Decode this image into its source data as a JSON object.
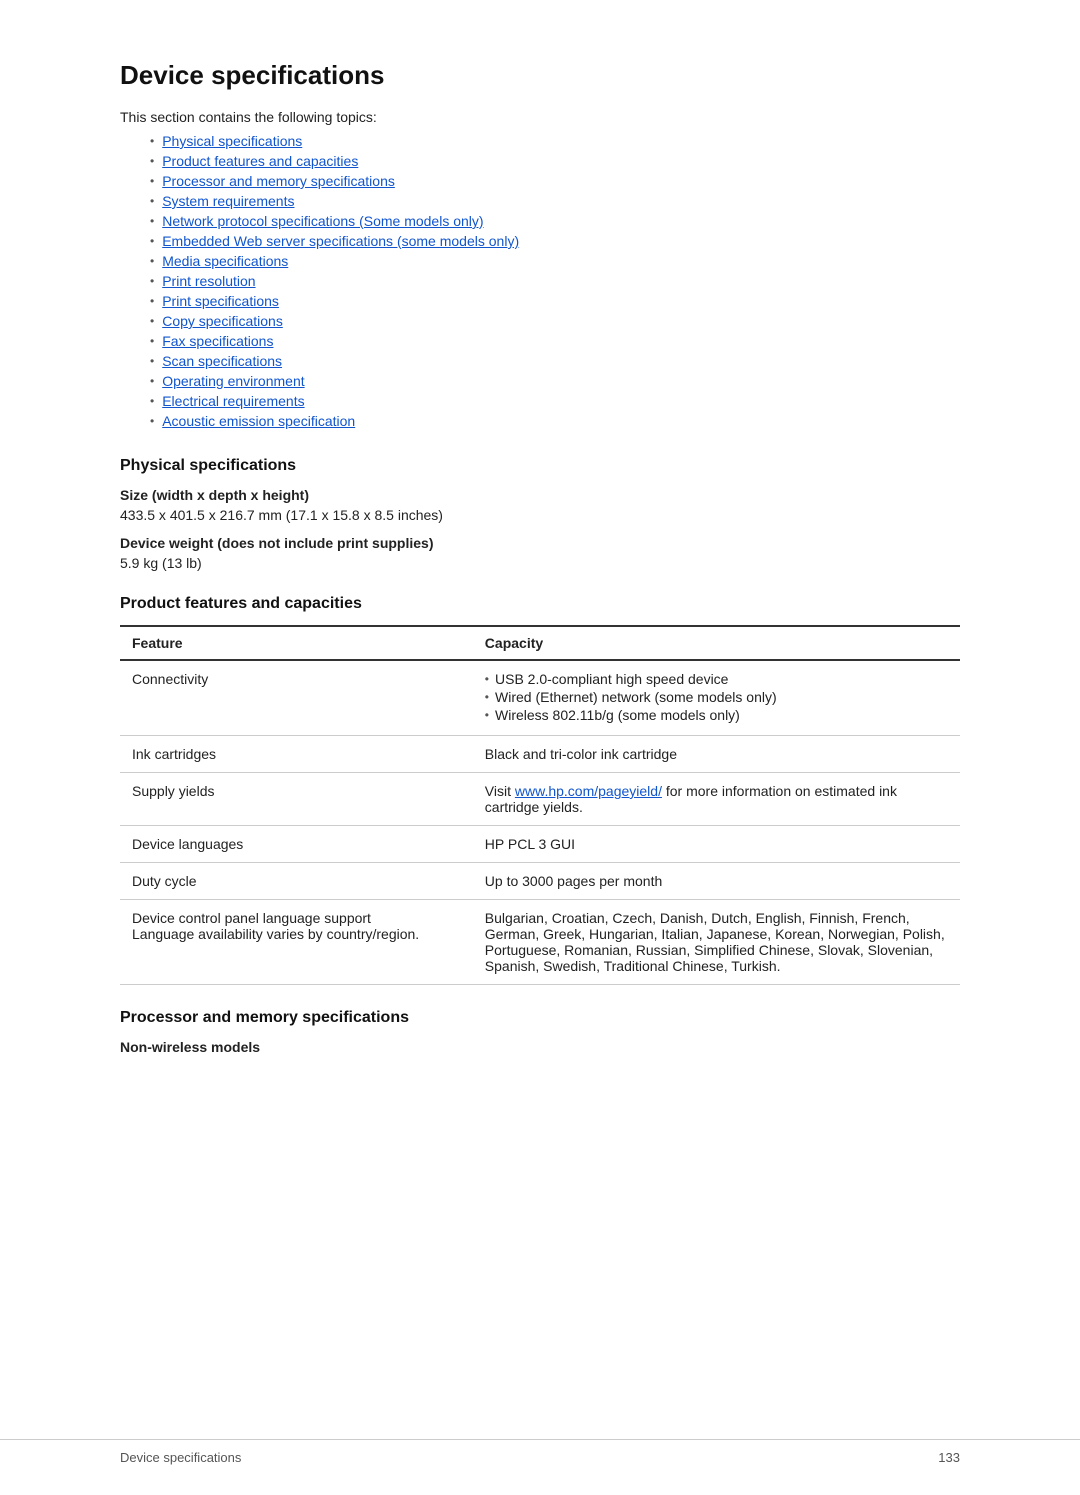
{
  "page": {
    "title": "Device specifications",
    "intro": "This section contains the following topics:"
  },
  "toc": {
    "items": [
      {
        "label": "Physical specifications",
        "href": "#physical"
      },
      {
        "label": "Product features and capacities",
        "href": "#features"
      },
      {
        "label": "Processor and memory specifications",
        "href": "#processor"
      },
      {
        "label": "System requirements",
        "href": "#system"
      },
      {
        "label": "Network protocol specifications (Some models only)",
        "href": "#network"
      },
      {
        "label": "Embedded Web server specifications (some models only)",
        "href": "#ews"
      },
      {
        "label": "Media specifications",
        "href": "#media"
      },
      {
        "label": "Print resolution",
        "href": "#printres"
      },
      {
        "label": "Print specifications",
        "href": "#printspec"
      },
      {
        "label": "Copy specifications",
        "href": "#copy"
      },
      {
        "label": "Fax specifications",
        "href": "#fax"
      },
      {
        "label": "Scan specifications",
        "href": "#scan"
      },
      {
        "label": "Operating environment",
        "href": "#operatingenv"
      },
      {
        "label": "Electrical requirements",
        "href": "#electrical"
      },
      {
        "label": "Acoustic emission specification",
        "href": "#acoustic"
      }
    ]
  },
  "physical": {
    "heading": "Physical specifications",
    "size_label": "Size (width x depth x height)",
    "size_value": "433.5 x 401.5 x 216.7 mm (17.1 x 15.8 x 8.5 inches)",
    "weight_label": "Device weight (does not include print supplies)",
    "weight_value": "5.9 kg (13 lb)"
  },
  "features": {
    "heading": "Product features and capacities",
    "table": {
      "col_feature": "Feature",
      "col_capacity": "Capacity",
      "rows": [
        {
          "feature": "Connectivity",
          "capacity_list": [
            "USB 2.0-compliant high speed device",
            "Wired (Ethernet) network (some models only)",
            "Wireless 802.11b/g (some models only)"
          ],
          "capacity_text": ""
        },
        {
          "feature": "Ink cartridges",
          "capacity_list": [],
          "capacity_text": "Black and tri-color ink cartridge"
        },
        {
          "feature": "Supply yields",
          "capacity_list": [],
          "capacity_text": "Visit www.hp.com/pageyield/ for more information on estimated ink cartridge yields.",
          "capacity_link": "www.hp.com/pageyield/",
          "capacity_link_href": "http://www.hp.com/pageyield/"
        },
        {
          "feature": "Device languages",
          "capacity_list": [],
          "capacity_text": "HP PCL 3 GUI"
        },
        {
          "feature": "Duty cycle",
          "capacity_list": [],
          "capacity_text": "Up to 3000 pages per month"
        },
        {
          "feature": "Device control panel language support\nLanguage availability varies by country/region.",
          "capacity_list": [],
          "capacity_text": "Bulgarian, Croatian, Czech, Danish, Dutch, English, Finnish, French, German, Greek, Hungarian, Italian, Japanese, Korean, Norwegian, Polish, Portuguese, Romanian, Russian, Simplified Chinese, Slovak, Slovenian, Spanish, Swedish, Traditional Chinese, Turkish."
        }
      ]
    }
  },
  "processor": {
    "heading": "Processor and memory specifications",
    "sub_heading": "Non-wireless models"
  },
  "footer": {
    "left": "Device specifications",
    "right": "133"
  }
}
